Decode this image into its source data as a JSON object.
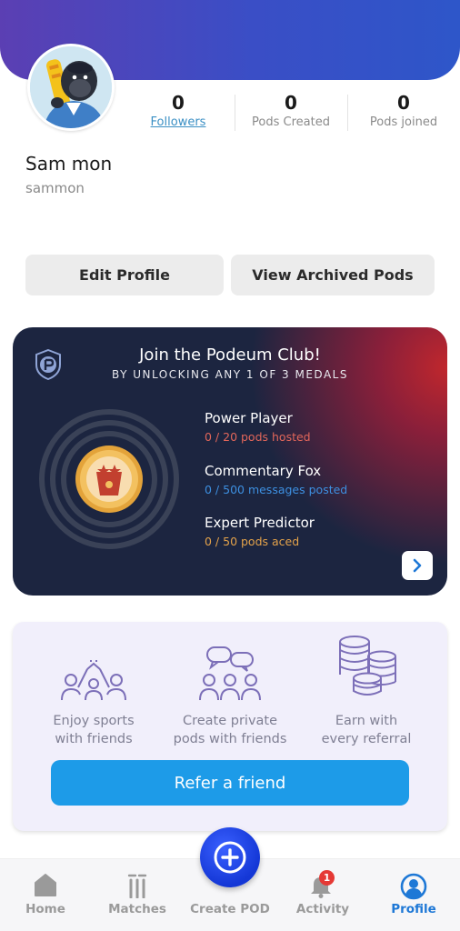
{
  "profile": {
    "name": "Sam mon",
    "username": "sammon"
  },
  "stats": [
    {
      "value": "0",
      "label": "Followers"
    },
    {
      "value": "0",
      "label": "Pods Created"
    },
    {
      "value": "0",
      "label": "Pods joined"
    }
  ],
  "actions": {
    "edit_profile": "Edit Profile",
    "view_archived": "View Archived Pods"
  },
  "club": {
    "title": "Join the Podeum Club!",
    "subtitle": "BY UNLOCKING ANY 1 OF 3 MEDALS",
    "medals": [
      {
        "name": "Power Player",
        "progress": "0 / 20 pods hosted",
        "color": "#e2665a"
      },
      {
        "name": "Commentary Fox",
        "progress": "0 / 500 messages posted",
        "color": "#3d8fe0"
      },
      {
        "name": "Expert Predictor",
        "progress": "0 / 50 pods aced",
        "color": "#e3a24a"
      }
    ]
  },
  "referral": {
    "features": [
      {
        "line1": "Enjoy sports",
        "line2": "with friends",
        "icon": "high-five-icon"
      },
      {
        "line1": "Create private",
        "line2": "pods with friends",
        "icon": "group-chat-icon"
      },
      {
        "line1": "Earn with",
        "line2": "every referral",
        "icon": "coins-icon"
      }
    ],
    "button": "Refer a friend"
  },
  "nav": {
    "items": [
      "Home",
      "Matches",
      "Create POD",
      "Activity",
      "Profile"
    ],
    "active": "Profile",
    "activity_badge": "1"
  },
  "colors": {
    "accent": "#1d9be8",
    "nav_active": "#1e78d6",
    "card_dark": "#1c2540"
  }
}
